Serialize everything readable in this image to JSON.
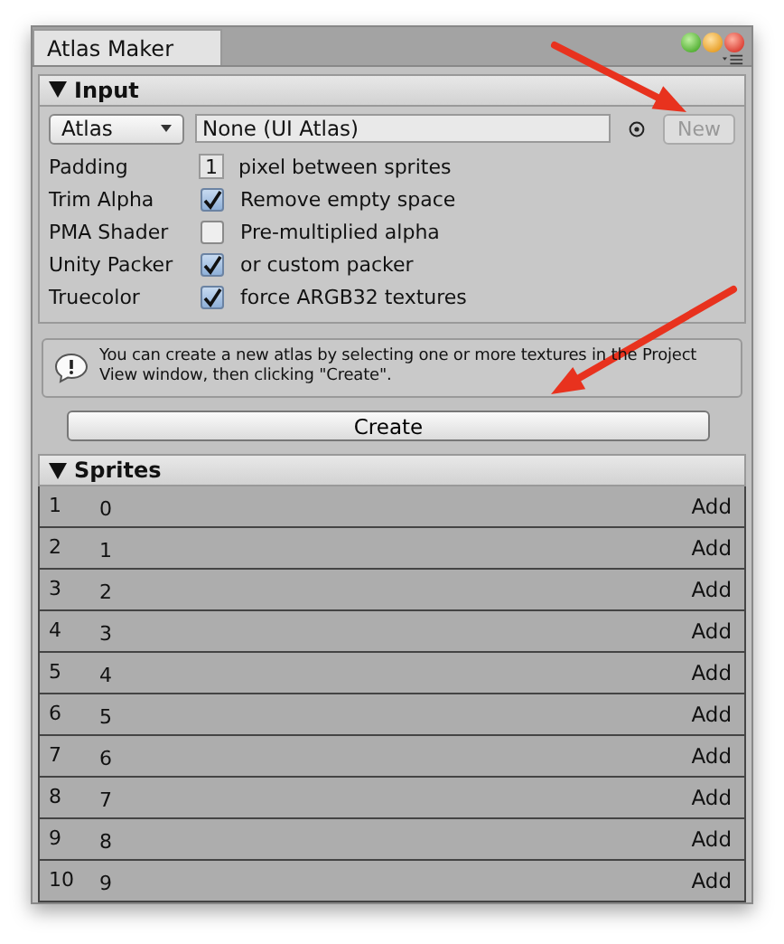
{
  "window": {
    "tab": "Atlas Maker"
  },
  "input": {
    "header": "Input",
    "atlas_dropdown": "Atlas",
    "atlas_field": "None (UI Atlas)",
    "new_button": {
      "label": "New",
      "disabled": true
    },
    "settings": [
      {
        "label": "Padding",
        "kind": "number",
        "value": "1",
        "description": "pixel between sprites"
      },
      {
        "label": "Trim Alpha",
        "kind": "checkbox",
        "checked": true,
        "description": "Remove empty space"
      },
      {
        "label": "PMA Shader",
        "kind": "checkbox",
        "checked": false,
        "description": "Pre-multiplied alpha"
      },
      {
        "label": "Unity Packer",
        "kind": "checkbox",
        "checked": true,
        "description": "or custom packer"
      },
      {
        "label": "Truecolor",
        "kind": "checkbox",
        "checked": true,
        "description": "force ARGB32 textures"
      }
    ]
  },
  "help": "You can create a new atlas by selecting one or more textures in the Project View window, then clicking \"Create\".",
  "create_button": "Create",
  "sprites": {
    "header": "Sprites",
    "rows": [
      {
        "index": "1",
        "name": "0",
        "action": "Add"
      },
      {
        "index": "2",
        "name": "1",
        "action": "Add"
      },
      {
        "index": "3",
        "name": "2",
        "action": "Add"
      },
      {
        "index": "4",
        "name": "3",
        "action": "Add"
      },
      {
        "index": "5",
        "name": "4",
        "action": "Add"
      },
      {
        "index": "6",
        "name": "5",
        "action": "Add"
      },
      {
        "index": "7",
        "name": "6",
        "action": "Add"
      },
      {
        "index": "8",
        "name": "7",
        "action": "Add"
      },
      {
        "index": "9",
        "name": "8",
        "action": "Add"
      },
      {
        "index": "10",
        "name": "9",
        "action": "Add"
      }
    ]
  }
}
